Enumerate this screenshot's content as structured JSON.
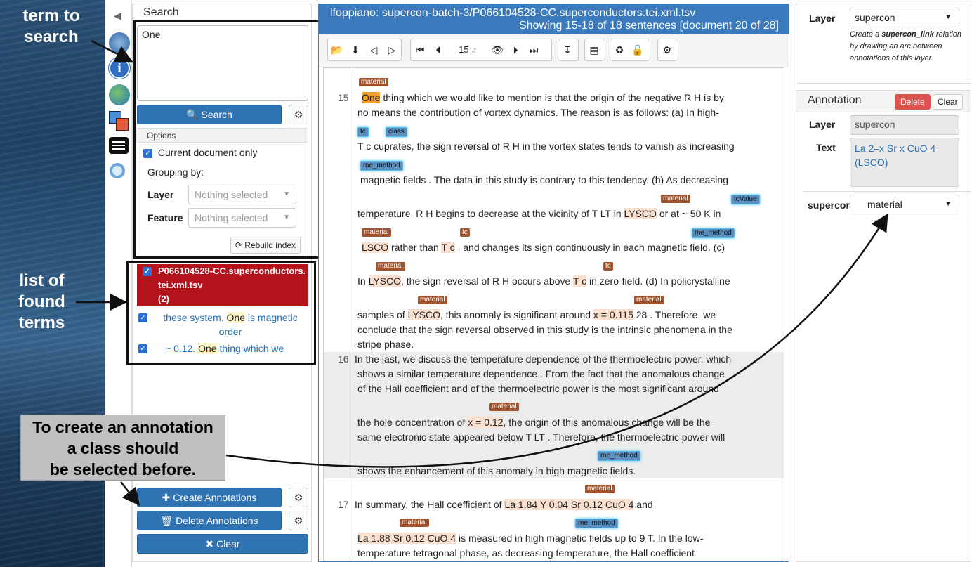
{
  "annotations": {
    "term_to_search": "term to\nsearch",
    "list_of_found_terms": "list of\nfound\nterms",
    "callout": "To create an annotation\na class should\nbe selected before."
  },
  "search": {
    "title": "Search",
    "query": "One",
    "search_button": "Search",
    "options_header": "Options",
    "current_doc_only": "Current document only",
    "grouping_by": "Grouping by:",
    "layer_label": "Layer",
    "feature_label": "Feature",
    "layer_placeholder": "Nothing selected",
    "feature_placeholder": "Nothing selected",
    "rebuild_index": "Rebuild index"
  },
  "results": {
    "doc_name": "P066104528-CC.superconductors.tei.xml.tsv",
    "doc_count": "(2)",
    "items": [
      {
        "pre": "these system. ",
        "match": "One",
        "post": " is magnetic",
        "post2": "order"
      },
      {
        "pre": "~ 0.12. ",
        "match": "One",
        "post": " thing which we"
      }
    ]
  },
  "actions": {
    "create": "Create Annotations",
    "delete": "Delete Annotations",
    "clear": "Clear"
  },
  "document": {
    "title": "lfoppiano: supercon-batch-3/P066104528-CC.superconductors.tei.xml.tsv",
    "showing": "Showing 15-18 of 18 sentences [document 20 of 28]",
    "page_value": "15"
  },
  "sentences": {
    "s15": {
      "num": "15",
      "l1a": "One",
      "l1b": "  thing which we would like to mention is that the origin of the negative R H is by",
      "l2": "no means the contribution of vortex dynamics. The reason is as follows: (a) In high-",
      "l3a": "T c",
      "l3b": "cuprates",
      "l3c": ", the sign reversal of R H in the vortex states tends to vanish as increasing",
      "l4a": "magnetic",
      "l4b": "  fields . The data in this study is contrary to this tendency. (b) As decreasing",
      "l5a": "temperature, R H begins to decrease at the vicinity of T LT in ",
      "l5b": "LYSCO",
      "l5c": " or at ~ ",
      "l5d": "50 K",
      "l5e": "   in",
      "l6a": "LSCO",
      "l6b": "  rather than ",
      "l6c": "T c",
      "l6d": " , and changes its sign continuously in each ",
      "l6e": "magnetic",
      "l6f": "  field. (c)",
      "l7a": "In ",
      "l7b": "LYSCO",
      "l7c": ", the sign reversal of R H occurs above ",
      "l7d": "T c",
      "l7e": " in zero-field. (d) In policrystalline",
      "l8a": "samples of ",
      "l8b": "LYSCO",
      "l8c": ", this anomaly is significant around ",
      "l8d": "x = 0.115",
      "l8e": " 28 . Therefore, we",
      "l9": "conclude that the sign reversal observed in this study is the intrinsic phenomena in the",
      "l10": "stripe phase."
    },
    "s16": {
      "num": "16",
      "l1": "In the last, we discuss the temperature dependence of the thermoelectric power, which",
      "l2": "shows a similar temperature dependence . From the fact that the anomalous change",
      "l3": "of the Hall coefficient and of the thermoelectric power is the most significant around",
      "l4a": "the hole concentration of ",
      "l4b": "x = 0.12",
      "l4c": ", the origin of this anomalous change will be the",
      "l5": "same electronic state appeared below T LT . Therefore, the thermoelectric power will",
      "l6a": "shows the enhancement of this anomaly in high  ",
      "l6b": "magnetic",
      "l6c": "  fields."
    },
    "s17": {
      "num": "17",
      "l1a": "In summary, the Hall coefficient of ",
      "l1b": "La 1.84 Y 0.04 Sr 0.12 CuO 4",
      "l1c": " and",
      "l2a": "La 1.88 Sr 0.12 CuO 4",
      "l2b": " is measured in high  ",
      "l2c": "magnetic",
      "l2d": "  fields up to 9 T. In the low-",
      "l3": "temperature tetragonal phase, as decreasing temperature, the Hall coefficient"
    }
  },
  "labels": {
    "material": "material",
    "tc": "tc",
    "class": "class",
    "me_method": "me_method",
    "tcValue": "tcValue"
  },
  "right": {
    "layer_label": "Layer",
    "layer_value": "supercon",
    "hint_pre": "Create a ",
    "hint_bold": "supercon_link",
    "hint_post": " relation by drawing an arc between annotations of this layer.",
    "annotation_title": "Annotation",
    "delete": "Delete",
    "clear": "Clear",
    "ann_layer_label": "Layer",
    "ann_layer_value": "supercon",
    "text_label": "Text",
    "text_value": "La 2–x Sr x CuO 4 (LSCO)",
    "feature_label": "supercon",
    "feature_value": "material"
  }
}
